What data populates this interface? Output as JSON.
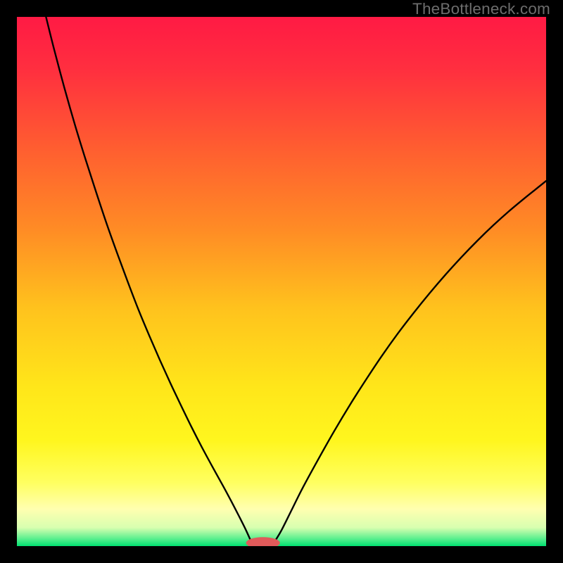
{
  "watermark": "TheBottleneck.com",
  "chart_data": {
    "type": "line",
    "title": "",
    "xlabel": "",
    "ylabel": "",
    "xlim": [
      0,
      100
    ],
    "ylim": [
      0,
      100
    ],
    "gradient_stops": [
      {
        "offset": 0.0,
        "color": "#ff1a44"
      },
      {
        "offset": 0.1,
        "color": "#ff2f3f"
      },
      {
        "offset": 0.25,
        "color": "#ff5e30"
      },
      {
        "offset": 0.4,
        "color": "#ff8b25"
      },
      {
        "offset": 0.55,
        "color": "#ffc21d"
      },
      {
        "offset": 0.7,
        "color": "#ffe61a"
      },
      {
        "offset": 0.8,
        "color": "#fff61e"
      },
      {
        "offset": 0.88,
        "color": "#ffff60"
      },
      {
        "offset": 0.93,
        "color": "#ffffb0"
      },
      {
        "offset": 0.965,
        "color": "#d8ffb0"
      },
      {
        "offset": 0.985,
        "color": "#60f090"
      },
      {
        "offset": 1.0,
        "color": "#00e070"
      }
    ],
    "series": [
      {
        "name": "left-curve",
        "x": [
          5.5,
          7,
          9,
          11,
          13,
          15,
          17,
          19,
          21,
          23,
          25,
          27,
          29,
          31,
          33,
          35,
          37,
          39,
          40.5,
          42,
          43.2,
          44.2
        ],
        "y": [
          100,
          94,
          86.5,
          79.5,
          73,
          66.8,
          60.8,
          55.2,
          49.8,
          44.6,
          39.8,
          35.2,
          30.8,
          26.6,
          22.5,
          18.6,
          14.9,
          11.3,
          8.5,
          5.6,
          3.2,
          1.0
        ]
      },
      {
        "name": "right-curve",
        "x": [
          48.8,
          50,
          52,
          54,
          57,
          60,
          63,
          66,
          69,
          72,
          75,
          78,
          81,
          84,
          87,
          90,
          93,
          96,
          98,
          100
        ],
        "y": [
          1.0,
          3.0,
          7.0,
          11.0,
          16.5,
          21.8,
          26.8,
          31.5,
          36.0,
          40.2,
          44.1,
          47.8,
          51.3,
          54.6,
          57.7,
          60.6,
          63.3,
          65.8,
          67.4,
          69.0
        ]
      }
    ],
    "marker": {
      "name": "min-marker",
      "cx": 46.5,
      "cy": 0.6,
      "rx": 3.2,
      "ry": 1.1,
      "color": "#e05a5a"
    }
  }
}
